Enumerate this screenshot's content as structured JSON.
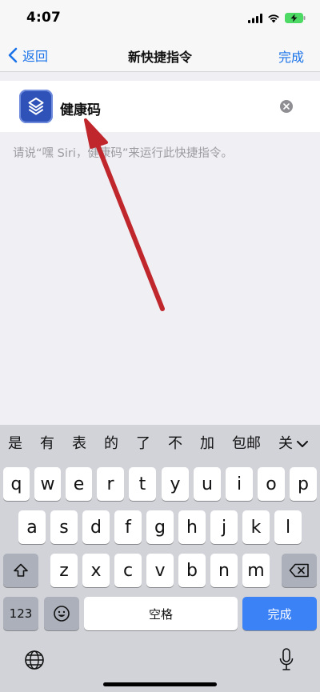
{
  "status_bar": {
    "time": "4:07"
  },
  "nav": {
    "back_label": "返回",
    "title": "新快捷指令",
    "done_label": "完成"
  },
  "shortcut": {
    "name": "健康码",
    "hint": "请说“嘿 Siri，健康码”来运行此快捷指令。"
  },
  "colors": {
    "accent": "#1a73e8",
    "icon_bg": "#2f52b8",
    "arrow": "#c0272d",
    "done_key": "#3b82f6"
  },
  "keyboard": {
    "candidates": [
      "是",
      "有",
      "表",
      "的",
      "了",
      "不",
      "加",
      "包邮",
      "关"
    ],
    "row1": [
      "q",
      "w",
      "e",
      "r",
      "t",
      "y",
      "u",
      "i",
      "o",
      "p"
    ],
    "row2": [
      "a",
      "s",
      "d",
      "f",
      "g",
      "h",
      "j",
      "k",
      "l"
    ],
    "row3": [
      "z",
      "x",
      "c",
      "v",
      "b",
      "n",
      "m"
    ],
    "numbers_label": "123",
    "space_label": "空格",
    "done_label": "完成",
    "icons": {
      "shift": "shift-icon",
      "delete": "backspace-icon",
      "emoji": "emoji-icon",
      "globe": "globe-icon",
      "mic": "microphone-icon",
      "collapse": "chevron-down-icon"
    }
  }
}
